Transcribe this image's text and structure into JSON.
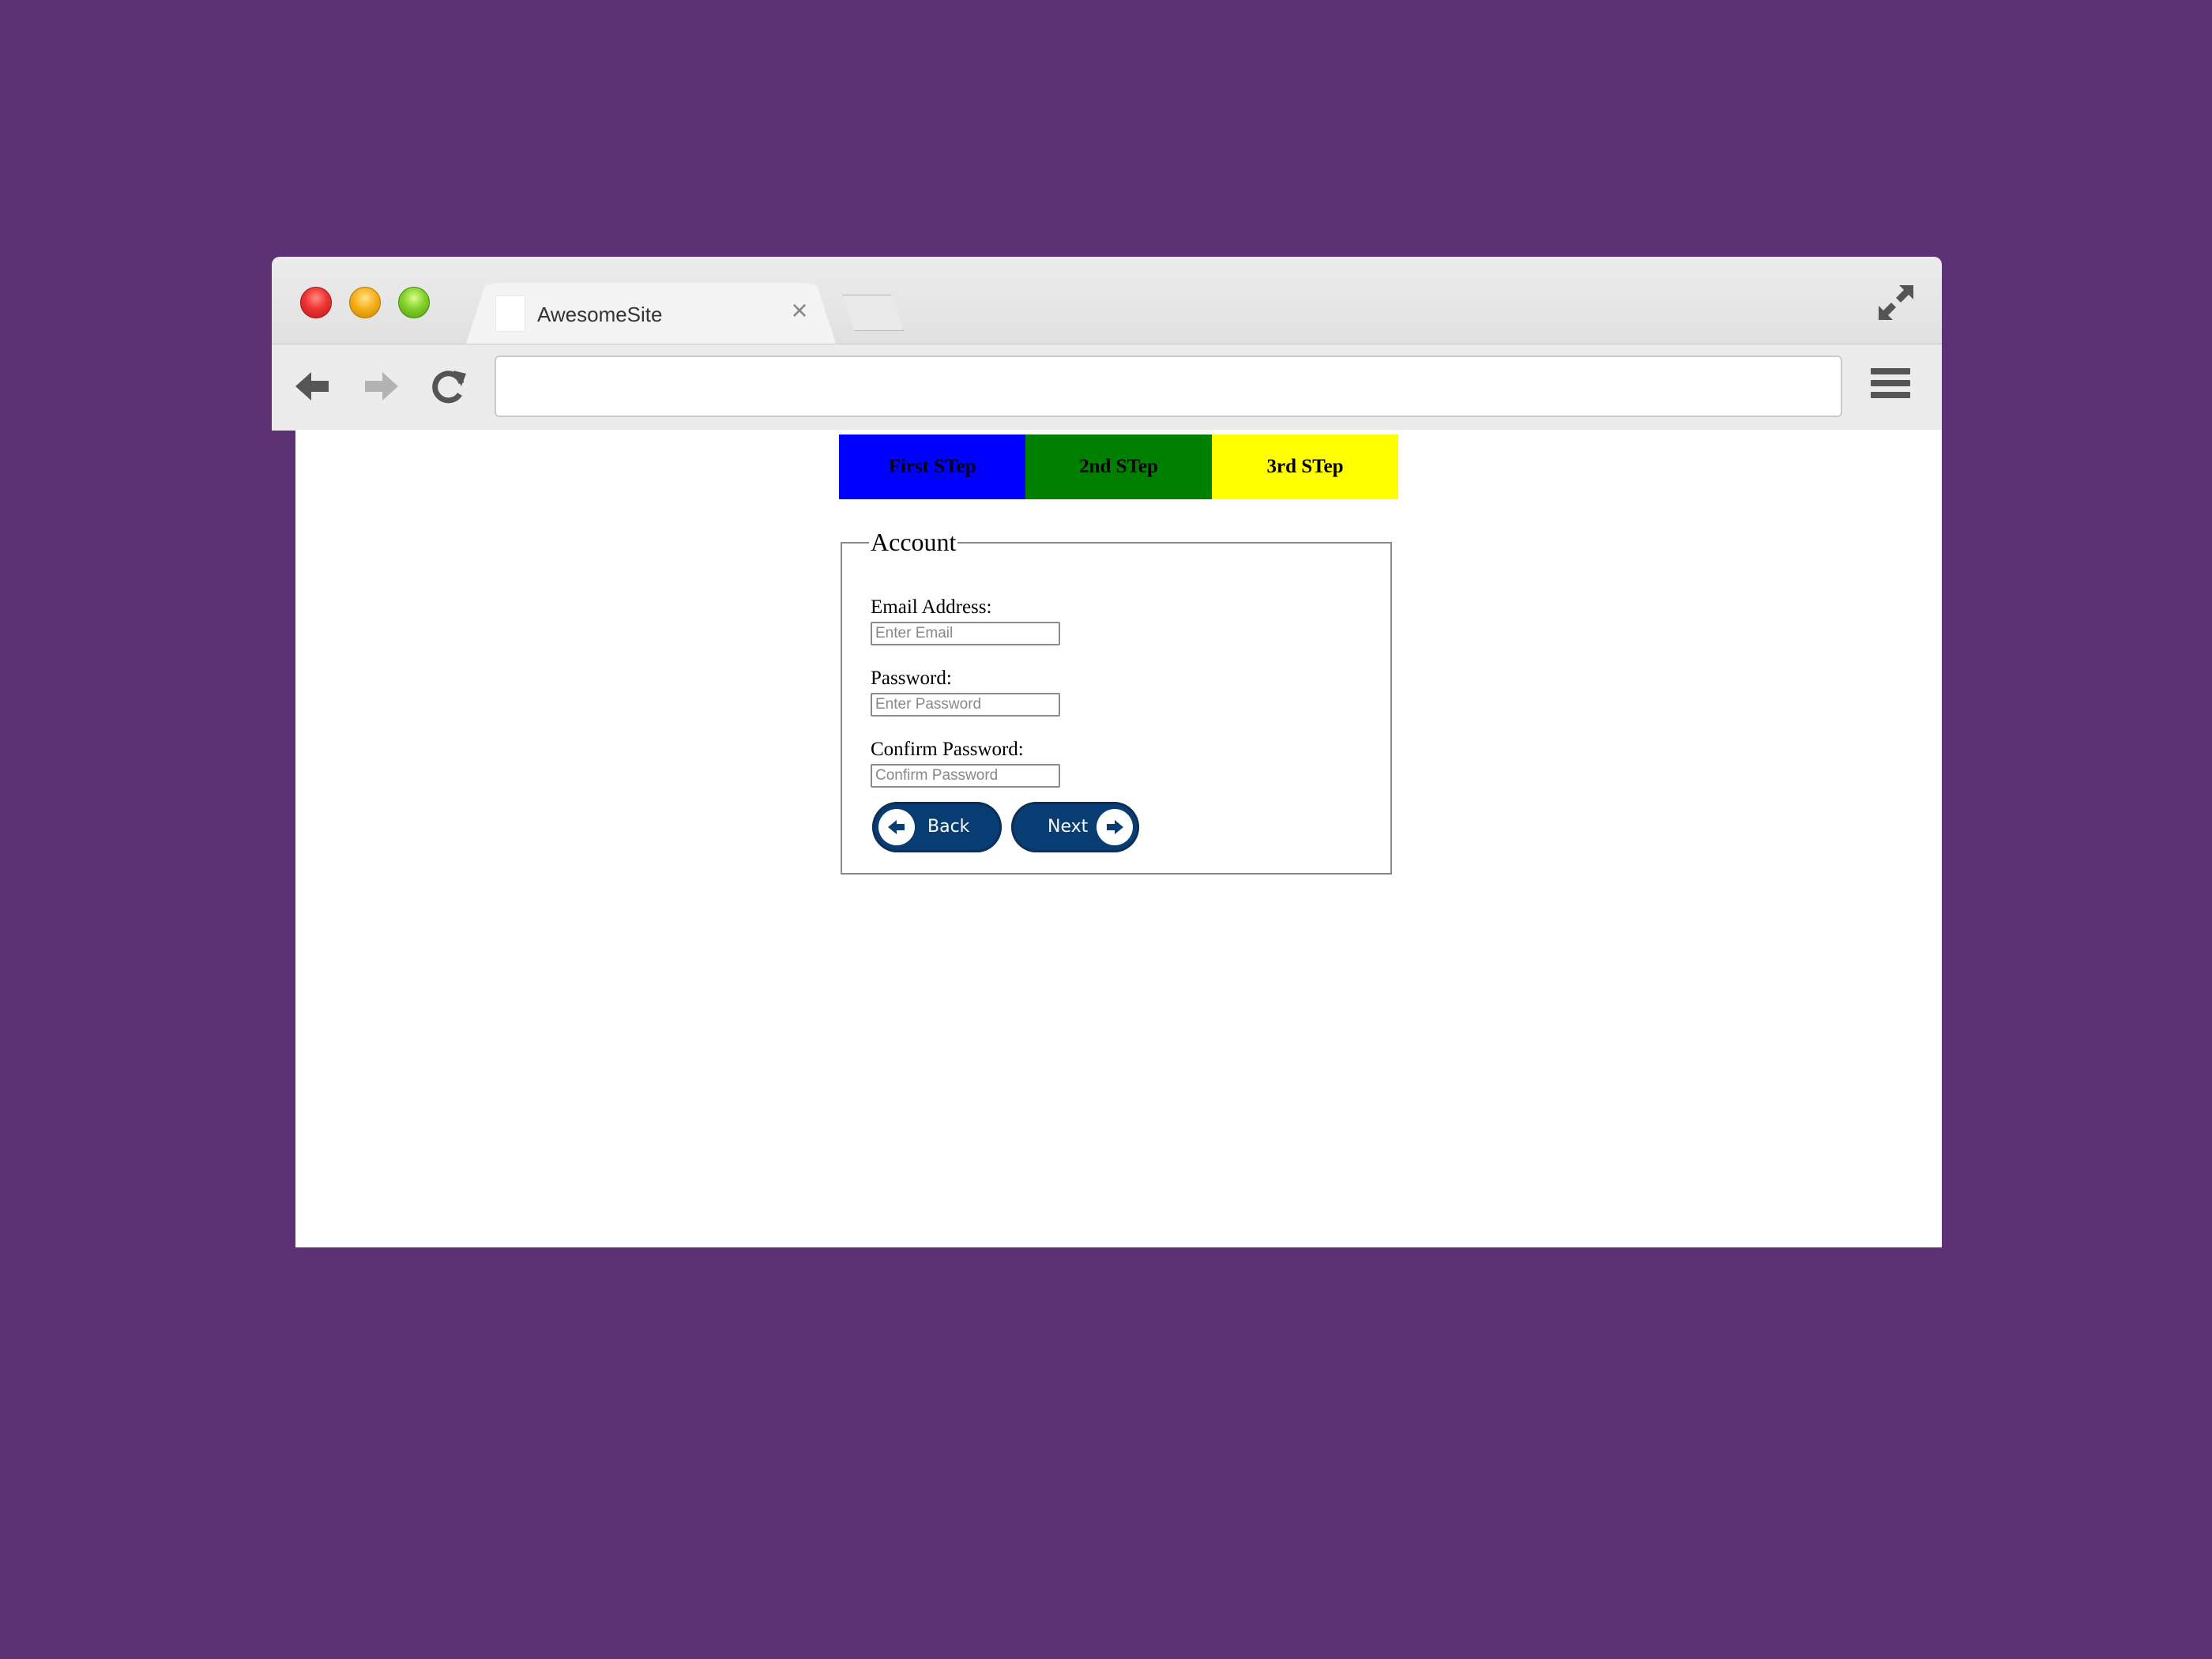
{
  "browser": {
    "tab_title": "AwesomeSite",
    "tab_close": "×",
    "url": ""
  },
  "steps": [
    {
      "label": "First STep",
      "color": "#0000ff"
    },
    {
      "label": "2nd STep",
      "color": "#008000"
    },
    {
      "label": "3rd STep",
      "color": "#ffff00"
    }
  ],
  "form": {
    "legend": "Account",
    "email_label": "Email Address:",
    "email_placeholder": "Enter Email",
    "password_label": "Password:",
    "password_placeholder": "Enter Password",
    "confirm_label": "Confirm Password:",
    "confirm_placeholder": "Confirm Password",
    "back_label": "Back",
    "next_label": "Next"
  },
  "colors": {
    "page_background": "#5d3275",
    "button_blue": "#083d73"
  },
  "icons": [
    "close-traffic-light",
    "minimize-traffic-light",
    "maximize-traffic-light",
    "page-icon",
    "close-icon",
    "new-tab-icon",
    "fullscreen-icon",
    "back-arrow-icon",
    "forward-arrow-icon",
    "reload-icon",
    "menu-icon",
    "left-arrow-icon",
    "right-arrow-icon"
  ]
}
